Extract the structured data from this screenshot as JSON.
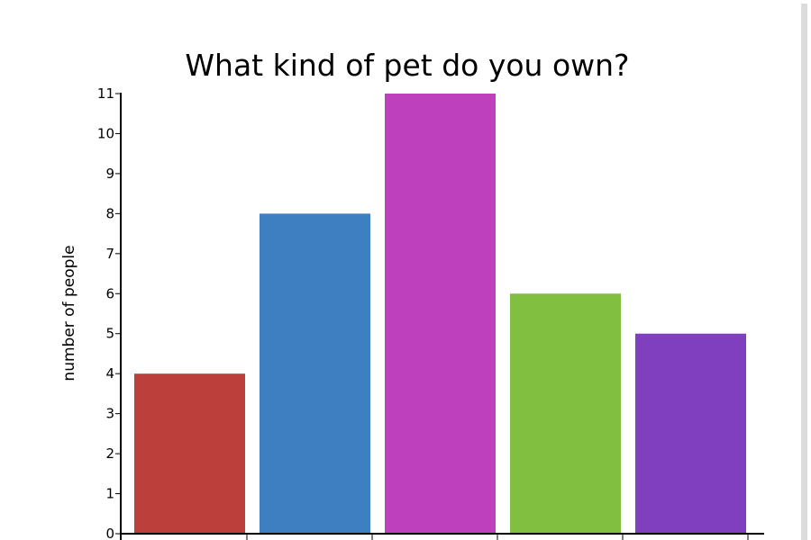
{
  "chart_data": {
    "type": "bar",
    "title": "What kind of pet do you own?",
    "xlabel": "",
    "ylabel": "number of people",
    "ylim": [
      0,
      11
    ],
    "yticks": [
      0,
      1,
      2,
      3,
      4,
      5,
      6,
      7,
      8,
      9,
      10,
      11
    ],
    "values": [
      4,
      8,
      11,
      6,
      5
    ],
    "colors": [
      "#bd3f3c",
      "#3e7fc1",
      "#be40bd",
      "#81bf41",
      "#7f3fbe"
    ],
    "grid": false,
    "legend": "none"
  }
}
